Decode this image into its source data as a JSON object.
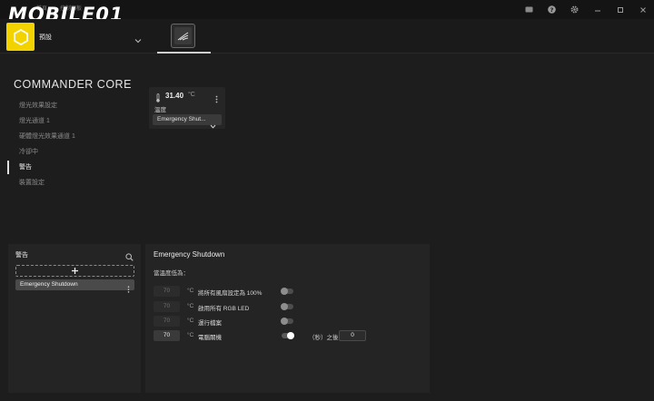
{
  "watermark": {
    "text": "MOBILE01"
  },
  "top_nav": {
    "items": [
      "首頁",
      "控制面板"
    ]
  },
  "window_controls": {
    "icons": [
      "message-icon",
      "help-icon",
      "settings-icon",
      "minimize-icon",
      "maximize-icon",
      "close-icon"
    ]
  },
  "header": {
    "profile_name": "預設",
    "profile_color": "#f2d300"
  },
  "device": {
    "title": "COMMANDER CORE"
  },
  "sidebar": {
    "items": [
      {
        "label": "燈光效果設定"
      },
      {
        "label": "燈光通道 1"
      },
      {
        "label": "硬體燈光效果通道 1"
      },
      {
        "label": "冷卻中"
      },
      {
        "label": "警告"
      },
      {
        "label": "裝置設定"
      }
    ],
    "active_index": 4
  },
  "sensor": {
    "value": "31.40",
    "unit": "°C",
    "label": "溫度",
    "selected_alert": "Emergency Shut..."
  },
  "alerts_panel": {
    "title": "警告",
    "add_symbol": "+",
    "items": [
      {
        "label": "Emergency Shutdown"
      }
    ]
  },
  "detail": {
    "title": "Emergency Shutdown",
    "condition": "當溫度低為：",
    "rows": [
      {
        "value": "70",
        "unit": "°C",
        "label": "將所有風扇設定為 100%",
        "enabled": false
      },
      {
        "value": "70",
        "unit": "°C",
        "label": "啟用所有 RGB LED",
        "enabled": false
      },
      {
        "value": "70",
        "unit": "°C",
        "label": "運行檔案",
        "enabled": false
      },
      {
        "value": "70",
        "unit": "°C",
        "label": "電腦關機",
        "enabled": true,
        "suffix": "（秒）之後",
        "delay": "0"
      }
    ]
  }
}
